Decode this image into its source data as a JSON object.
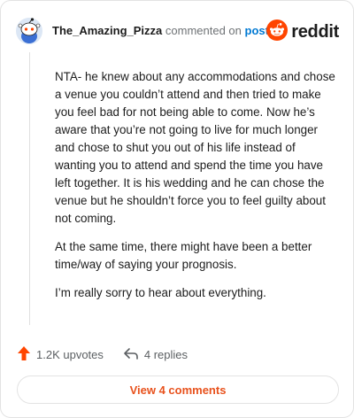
{
  "header": {
    "username": "The_Amazing_Pizza",
    "commented_text": "commented on",
    "post_link": "post",
    "logo_text": "reddit"
  },
  "comment": {
    "paragraphs": [
      "NTA- he knew about any accommodations and chose a venue you couldn’t attend and then tried to make you feel bad for not being able to come. Now he’s aware that you’re not going to live for much longer and chose to shut you out of his life instead of wanting you to attend and spend the time you have left together. It is his wedding and he can chose the venue but he shouldn’t force you to feel guilty about not coming.",
      "At the same time, there might have been a better time/way of saying your prognosis.",
      "I’m really sorry to hear about everything."
    ]
  },
  "actions": {
    "upvotes": "1.2K upvotes",
    "replies": "4 replies"
  },
  "view_comments_label": "View 4 comments",
  "colors": {
    "accent": "#ff4500",
    "link": "#0079d3",
    "view_button_text": "#e8521d"
  },
  "icons": {
    "avatar": "snoo-avatar-icon",
    "logo": "reddit-logo-icon",
    "upvote": "upvote-arrow-icon",
    "reply": "reply-arrow-icon"
  }
}
